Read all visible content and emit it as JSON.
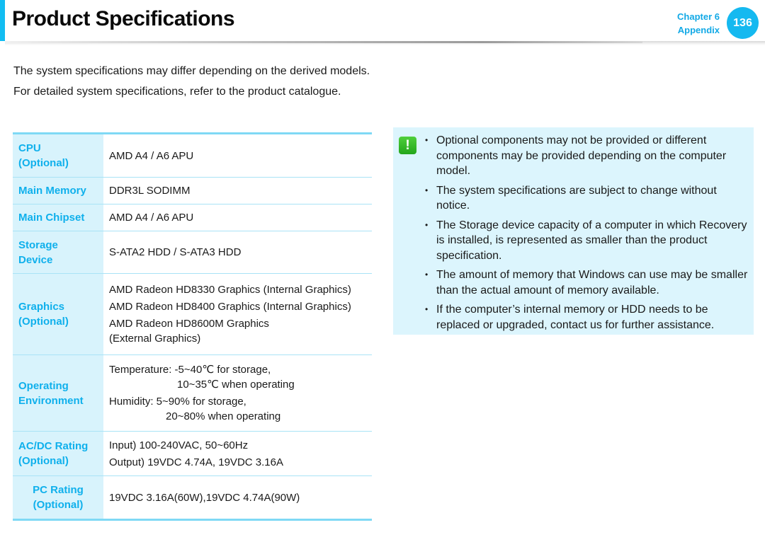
{
  "header": {
    "title": "Product Specifications",
    "chapter": "Chapter 6",
    "section": "Appendix",
    "page_number": "136",
    "accent_color": "#12bdf2"
  },
  "intro": {
    "paragraphs": [
      "The system specifications may differ depending on the derived models.",
      "For detailed system specifications, refer to the product catalogue."
    ]
  },
  "specs": {
    "rows": [
      {
        "label": [
          "CPU",
          "(Optional)"
        ],
        "values": [
          "AMD A4 / A6 APU"
        ]
      },
      {
        "label": [
          "Main Memory"
        ],
        "values": [
          "DDR3L SODIMM"
        ]
      },
      {
        "label": [
          "Main Chipset"
        ],
        "values": [
          "AMD A4 / A6 APU"
        ]
      },
      {
        "label": [
          "Storage",
          "Device"
        ],
        "values": [
          "S-ATA2 HDD / S-ATA3 HDD"
        ]
      },
      {
        "label": [
          "Graphics",
          "(Optional)"
        ],
        "values": [
          "AMD Radeon HD8330 Graphics (Internal Graphics)",
          "AMD Radeon HD8400 Graphics (Internal Graphics)",
          "AMD Radeon HD8600M Graphics",
          "(External Graphics)"
        ]
      },
      {
        "label": [
          "Operating",
          "Environment"
        ],
        "values": [
          "Temperature: -5~40℃ for storage,",
          "10~35℃ when operating",
          "Humidity: 5~90% for storage,",
          "20~80% when operating"
        ]
      },
      {
        "label": [
          "AC/DC Rating",
          "(Optional)"
        ],
        "values": [
          "Input) 100-240VAC, 50~60Hz",
          "Output) 19VDC 4.74A, 19VDC 3.16A"
        ]
      },
      {
        "label": [
          "PC Rating",
          "(Optional)"
        ],
        "values": [
          "19VDC 3.16A(60W),19VDC 4.74A(90W)"
        ]
      }
    ]
  },
  "note": {
    "icon": "exclamation-icon",
    "items": [
      "Optional components may not be provided or different components may be provided depending on the computer model.",
      "The system specifications are subject to change without notice.",
      "The Storage device capacity of a computer in which Recovery is installed, is represented as smaller than the product specification.",
      "The amount of memory that Windows can use may be smaller than the actual amount of memory available.",
      "If the computer’s internal memory or HDD needs to be replaced or upgraded, contact us for further assistance."
    ]
  }
}
